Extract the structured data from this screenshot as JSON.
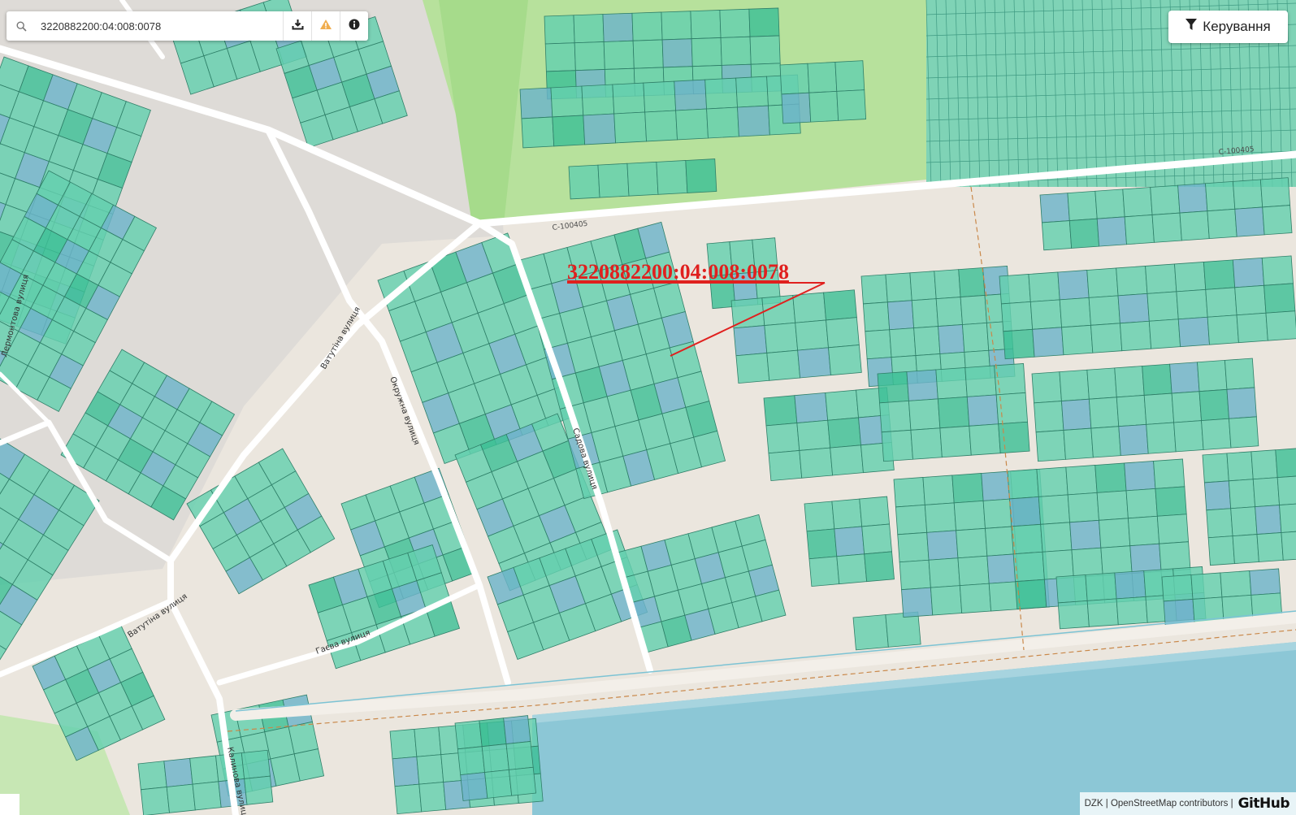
{
  "search": {
    "value": "3220882200:04:008:0078",
    "placeholder": "",
    "icons": [
      "search-icon",
      "download-icon",
      "warning-icon",
      "info-icon"
    ]
  },
  "controls": {
    "label": "Керування",
    "icon": "filter-icon"
  },
  "annotation": {
    "text": "3220882200:04:008:0078",
    "color": "#e0201e"
  },
  "roads": [
    "C-100405",
    "C-100405",
    "Ватутіна вулиця",
    "Ватутіна вулиця",
    "Окружна вулиця",
    "Садова вулиця",
    "Гаєва вулиця",
    "Калинова вулиця",
    "Лермонтова вулиця"
  ],
  "attribution": {
    "text": "DZK | OpenStreetMap contributors |",
    "github": "GitHub"
  },
  "colors": {
    "parcel_green": "#64cfae",
    "parcel_blue": "#6db3c9",
    "parcel_dark": "#3dbf96",
    "forest": "#b8e39f",
    "water": "#8cc8d8",
    "road": "#ffffff",
    "annotation": "#e0201e",
    "warning": "#f0ad4e"
  }
}
